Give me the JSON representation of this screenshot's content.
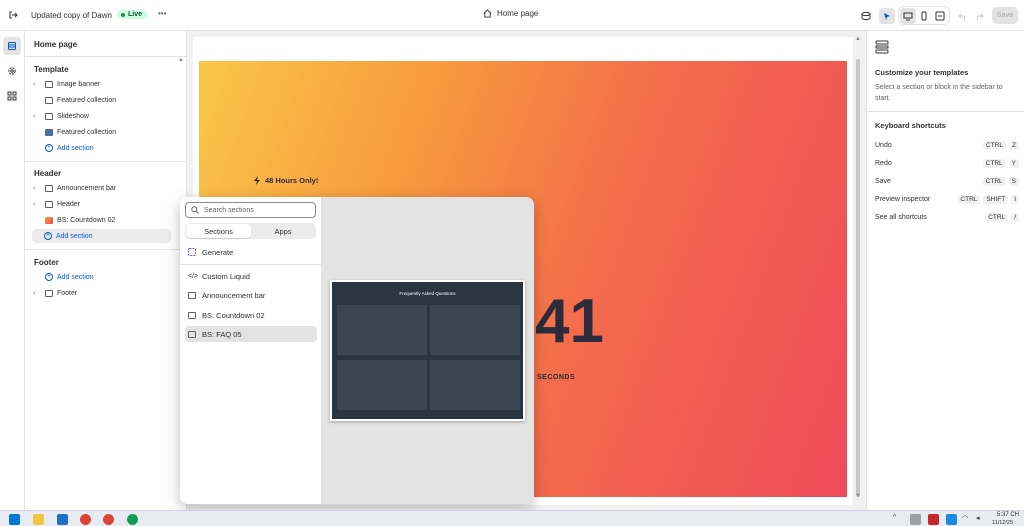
{
  "topbar": {
    "store_title": "Updated copy of Dawn",
    "status_badge": "Live",
    "more_label": "•••",
    "page_selector": "Home page",
    "save_label": "Save"
  },
  "sidebar": {
    "page_title": "Home page",
    "template": {
      "heading": "Template",
      "items": [
        {
          "label": "Image banner",
          "expandable": true
        },
        {
          "label": "Featured collection",
          "expandable": false
        },
        {
          "label": "Slideshow",
          "expandable": true
        },
        {
          "label": "Featured collection",
          "expandable": false
        }
      ],
      "add_section": "Add section"
    },
    "header": {
      "heading": "Header",
      "items": [
        {
          "label": "Announcement bar",
          "expandable": true
        },
        {
          "label": "Header",
          "expandable": true
        },
        {
          "label": "BS: Countdown 02",
          "expandable": false
        }
      ],
      "add_section": "Add section"
    },
    "footer": {
      "heading": "Footer",
      "add_section": "Add section",
      "items": [
        {
          "label": "Footer",
          "expandable": true
        }
      ]
    }
  },
  "preview": {
    "banner_badge": "48 Hours Only!",
    "countdown_number": "41",
    "countdown_unit": "SECONDS"
  },
  "add_section_popup": {
    "search_placeholder": "Search sections",
    "tabs": [
      "Sections",
      "Apps"
    ],
    "active_tab": "Sections",
    "generate_label": "Generate",
    "items": [
      "Custom Liquid",
      "Announcement bar",
      "BS: Countdown 02",
      "BS: FAQ 05"
    ],
    "selected_item": "BS: FAQ 05",
    "thumbnail_title": "Frequently Asked Questions"
  },
  "right_panel": {
    "title": "Customize your templates",
    "description": "Select a section or block in the sidebar to start.",
    "shortcuts_heading": "Keyboard shortcuts",
    "shortcuts": [
      {
        "label": "Undo",
        "keys": [
          "CTRL",
          "Z"
        ]
      },
      {
        "label": "Redo",
        "keys": [
          "CTRL",
          "Y"
        ]
      },
      {
        "label": "Save",
        "keys": [
          "CTRL",
          "S"
        ]
      },
      {
        "label": "Preview inspector",
        "keys": [
          "CTRL",
          "SHIFT",
          "I"
        ]
      },
      {
        "label": "See all shortcuts",
        "keys": [
          "CTRL",
          "/"
        ]
      }
    ]
  },
  "taskbar": {
    "time": "5:37 CH",
    "date": "11/12/25"
  },
  "colors": {
    "accent": "#005bd3",
    "live_bg": "#cdfee1",
    "banner_start": "#f9c74a",
    "banner_end": "#ee4b5a"
  }
}
